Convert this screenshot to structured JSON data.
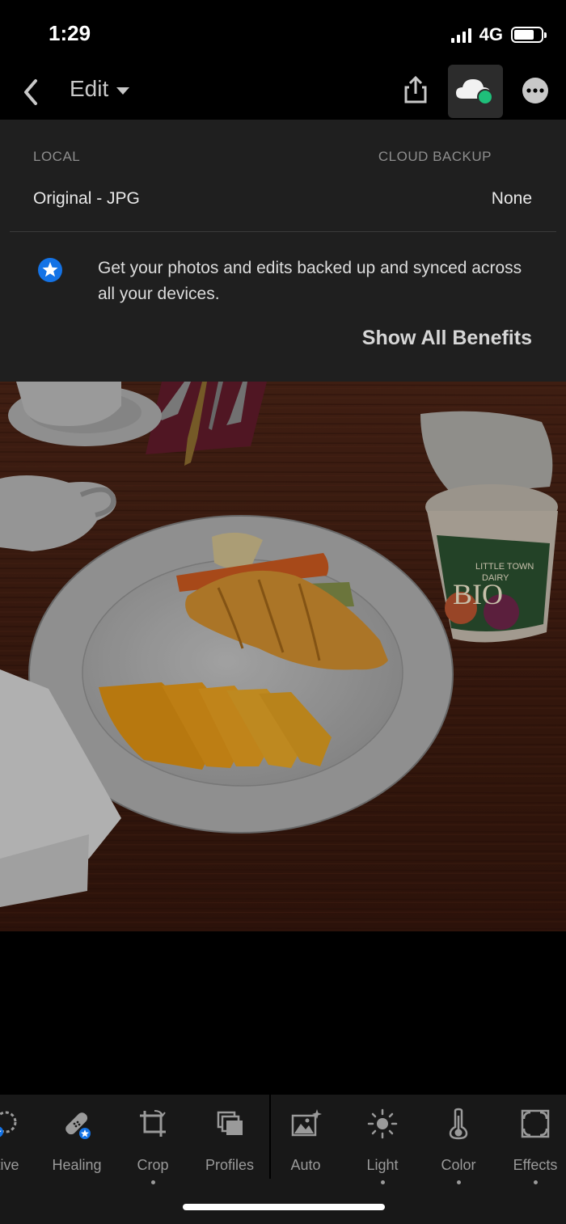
{
  "status_bar": {
    "time": "1:29",
    "network": "4G"
  },
  "nav": {
    "edit_label": "Edit",
    "icons": [
      "chevron-left-icon",
      "caret-down-icon",
      "share-icon",
      "cloud-sync-icon",
      "more-icon"
    ]
  },
  "cloud_panel": {
    "local_header": "LOCAL",
    "cloud_header": "CLOUD BACKUP",
    "local_value": "Original - JPG",
    "cloud_value": "None",
    "promo_text": "Get your photos and edits backed up and synced across all your devices.",
    "benefits_link": "Show All Benefits",
    "accent": "#1473e6"
  },
  "photo": {
    "description_icon": "photo-image",
    "plate_label_line1": "LITTLE TOWN",
    "plate_label_line2": "DAIRY",
    "plate_label_brand": "BIO"
  },
  "toolbar": {
    "tools": [
      {
        "label": "ctive",
        "icon": "selective-icon",
        "premium": true
      },
      {
        "label": "Healing",
        "icon": "healing-icon",
        "premium": true
      },
      {
        "label": "Crop",
        "icon": "crop-icon",
        "premium": false,
        "dot": true
      },
      {
        "label": "Profiles",
        "icon": "profiles-icon",
        "premium": false
      },
      {
        "label": "Auto",
        "icon": "auto-icon",
        "premium": false
      },
      {
        "label": "Light",
        "icon": "light-icon",
        "premium": false,
        "dot": true
      },
      {
        "label": "Color",
        "icon": "color-icon",
        "premium": false,
        "dot": true
      },
      {
        "label": "Effects",
        "icon": "effects-icon",
        "premium": false,
        "dot": true
      }
    ]
  }
}
